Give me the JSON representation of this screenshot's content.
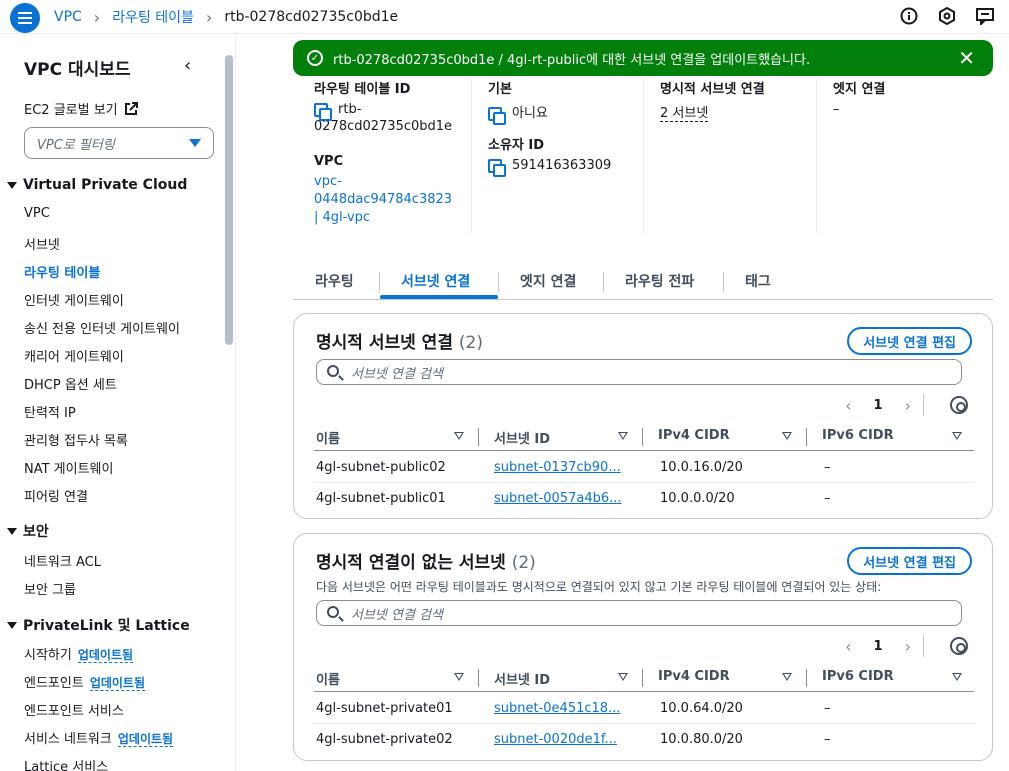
{
  "breadcrumb": {
    "items": [
      "VPC",
      "라우팅 테이블"
    ],
    "current": "rtb-0278cd02735c0bd1e"
  },
  "sidebar": {
    "title": "VPC 대시보드",
    "ec2_link": "EC2 글로벌 보기",
    "filter_placeholder": "VPC로 필터링",
    "section1": "Virtual Private Cloud",
    "items1": [
      "VPC",
      "서브넷",
      "라우팅 테이블",
      "인터넷 게이트웨이",
      "송신 전용 인터넷 게이트웨이",
      "캐리어 게이트웨이",
      "DHCP 옵션 세트",
      "탄력적 IP",
      "관리형 접두사 목록",
      "NAT 게이트웨이",
      "피어링 연결"
    ],
    "section2": "보안",
    "items2": [
      "네트워크 ACL",
      "보안 그룹"
    ],
    "section3": "PrivateLink 및 Lattice",
    "items3": [
      "시작하기",
      "엔드포인트",
      "엔드포인트 서비스",
      "서비스 네트워크",
      "Lattice 서비스"
    ],
    "badge": "업데이트됨"
  },
  "flash": {
    "message": "rtb-0278cd02735c0bd1e / 4gl-rt-public에 대한 서브넷 연결을 업데이트했습니다."
  },
  "details": {
    "rt_id_label": "라우팅 테이블 ID",
    "rt_id_line1": "rtb-",
    "rt_id_line2": "0278cd02735c0bd1e",
    "vpc_label": "VPC",
    "vpc_line1": "vpc-",
    "vpc_line2": "0448dac94784c3823",
    "vpc_line3": "| 4gl-vpc",
    "main_label": "기본",
    "main_value": "아니요",
    "owner_label": "소유자 ID",
    "owner_value": "591416363309",
    "explicit_label": "명시적 서브넷 연결",
    "explicit_value": "2 서브넷",
    "edge_label": "엣지 연결",
    "edge_value": "–"
  },
  "tabs": [
    "라우팅",
    "서브넷 연결",
    "엣지 연결",
    "라우팅 전파",
    "태그"
  ],
  "panel1": {
    "title": "명시적 서브넷 연결",
    "count": "(2)",
    "button": "서브넷 연결 편집",
    "search_placeholder": "서브넷 연결 검색",
    "page": "1",
    "columns": [
      "이름",
      "서브넷 ID",
      "IPv4 CIDR",
      "IPv6 CIDR"
    ],
    "rows": [
      {
        "name": "4gl-subnet-public02",
        "subnet": "subnet-0137cb90...",
        "ipv4": "10.0.16.0/20",
        "ipv6": "–"
      },
      {
        "name": "4gl-subnet-public01",
        "subnet": "subnet-0057a4b6...",
        "ipv4": "10.0.0.0/20",
        "ipv6": "–"
      }
    ]
  },
  "panel2": {
    "title": "명시적 연결이 없는 서브넷",
    "count": "(2)",
    "button": "서브넷 연결 편집",
    "description": "다음 서브넷은 어떤 라우팅 테이블과도 명시적으로 연결되어 있지 않고 기본 라우팅 테이블에 연결되어 있는 상태:",
    "search_placeholder": "서브넷 연결 검색",
    "page": "1",
    "columns": [
      "이름",
      "서브넷 ID",
      "IPv4 CIDR",
      "IPv6 CIDR"
    ],
    "rows": [
      {
        "name": "4gl-subnet-private01",
        "subnet": "subnet-0e451c18...",
        "ipv4": "10.0.64.0/20",
        "ipv6": "–"
      },
      {
        "name": "4gl-subnet-private02",
        "subnet": "subnet-0020de1f...",
        "ipv4": "10.0.80.0/20",
        "ipv6": "–"
      }
    ]
  }
}
